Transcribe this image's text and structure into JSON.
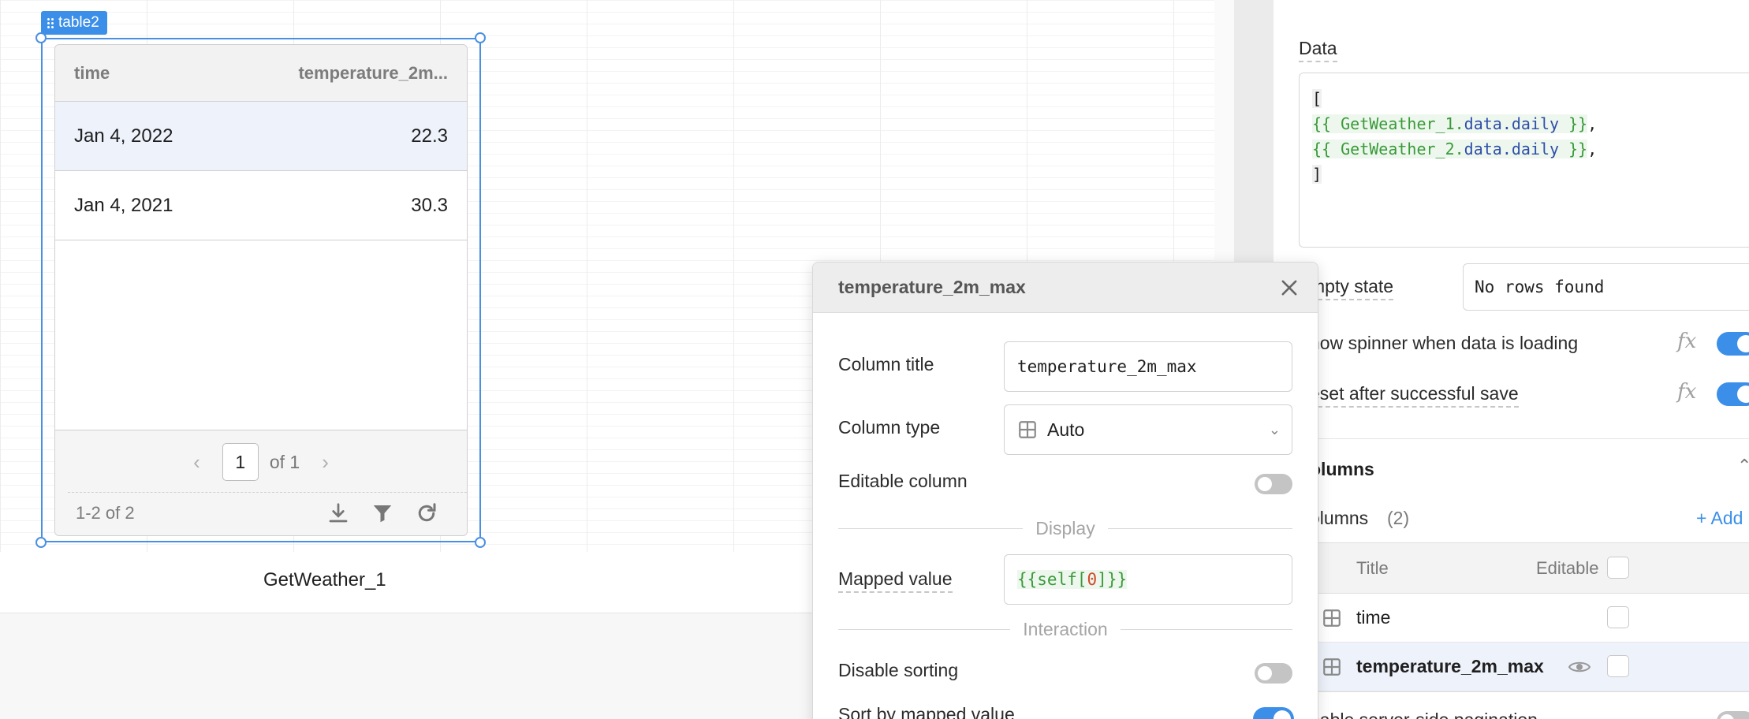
{
  "component": {
    "tag_label": "table2",
    "bottom_label": "GetWeather_1"
  },
  "table": {
    "headers": [
      "time",
      "temperature_2m..."
    ],
    "rows": [
      {
        "time": "Jan 4, 2022",
        "value": "22.3"
      },
      {
        "time": "Jan 4, 2021",
        "value": "30.3"
      }
    ],
    "page_input": "1",
    "page_of": "of 1",
    "row_count": "1-2 of 2",
    "icons": [
      "download-icon",
      "filter-icon",
      "refresh-icon"
    ]
  },
  "panel": {
    "data_label": "Data",
    "data_code": {
      "open": "[",
      "line1_expr": "{{ GetWeather_1.",
      "line1_prop": "data.daily",
      "line1_close": " }}",
      "line2_expr": "{{ GetWeather_2.",
      "line2_prop": "data.daily",
      "line2_close": " }}",
      "comma": ",",
      "close": "]"
    },
    "empty_state_label": "mpty state",
    "empty_state_value": "No rows found",
    "spinner_label": "how spinner when data is loading",
    "reset_label": "eset after successful save",
    "fx_symbol": "fx",
    "columns_section": "olumns",
    "columns_list_label": "olumns",
    "columns_count": "(2)",
    "add_label": "+ Add",
    "cols_header_title": "Title",
    "cols_header_editable": "Editable",
    "cols": [
      "time",
      "temperature_2m_max"
    ],
    "next_row_label": "nable server-side pagination"
  },
  "popover": {
    "title": "temperature_2m_max",
    "column_title_label": "Column title",
    "column_title_value": "temperature_2m_max",
    "column_type_label": "Column type",
    "column_type_value": "Auto",
    "editable_label": "Editable column",
    "display_section": "Display",
    "mapped_value_label": "Mapped value",
    "mapped_value_open": "{{self[",
    "mapped_value_index": "0",
    "mapped_value_close": "]}}",
    "interaction_section": "Interaction",
    "disable_sorting_label": "Disable sorting",
    "sort_mapped_label": "Sort by mapped value"
  },
  "colors": {
    "accent": "#3b8fe8",
    "code_green": "#3a9a3a",
    "code_blue": "#2d4ea8",
    "code_red": "#d04a2a"
  }
}
